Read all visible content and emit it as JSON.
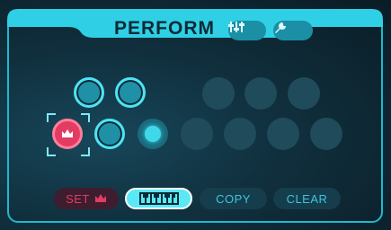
{
  "header": {
    "title": "PERFORM",
    "mixer_icon": "mixer-sliders-icon",
    "settings_icon": "wrench-icon"
  },
  "pads": {
    "row1": [
      "active",
      "active",
      "dim",
      "dim",
      "dim"
    ],
    "row2": [
      "selected",
      "active",
      "center",
      "dim",
      "dim",
      "dim",
      "dim",
      "dim"
    ]
  },
  "buttons": {
    "set_label": "SET",
    "set_icon": "crown-icon",
    "keyboard_icon": "piano-keyboard-icon",
    "copy_label": "COPY",
    "clear_label": "CLEAR"
  },
  "colors": {
    "accent": "#4fe3f2",
    "highlight": "#e23c63",
    "background": "#0d2430"
  }
}
